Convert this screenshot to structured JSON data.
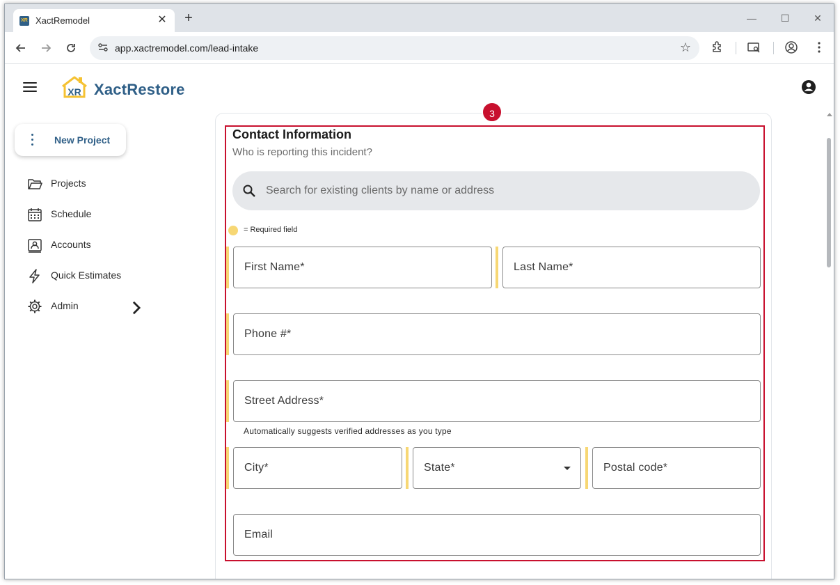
{
  "browser": {
    "tab_title": "XactRemodel",
    "favicon_text": "XR",
    "new_tab": "+",
    "url": "app.xactremodel.com/lead-intake"
  },
  "app": {
    "brand": "XactRestore",
    "logo_text": "XR",
    "brand_color": "#2f5f87",
    "accent_color": "#f5c233"
  },
  "sidebar": {
    "new_project_label": "New Project",
    "items": [
      {
        "label": "Projects",
        "icon": "folder-icon"
      },
      {
        "label": "Schedule",
        "icon": "calendar-icon"
      },
      {
        "label": "Accounts",
        "icon": "contact-card-icon"
      },
      {
        "label": "Quick Estimates",
        "icon": "lightning-icon"
      },
      {
        "label": "Admin",
        "icon": "gear-icon"
      }
    ]
  },
  "form": {
    "step_badge": "3",
    "title": "Contact Information",
    "subtitle": "Who is reporting this incident?",
    "search_placeholder": "Search for existing clients by name or address",
    "required_legend": "= Required field",
    "first_name": "First Name*",
    "last_name": "Last Name*",
    "phone": "Phone #*",
    "street": "Street Address*",
    "street_helper": "Automatically suggests verified addresses as you type",
    "city": "City*",
    "state": "State*",
    "postal": "Postal code*",
    "email": "Email",
    "required_color": "#f7d774",
    "highlight_color": "#c8102e"
  }
}
